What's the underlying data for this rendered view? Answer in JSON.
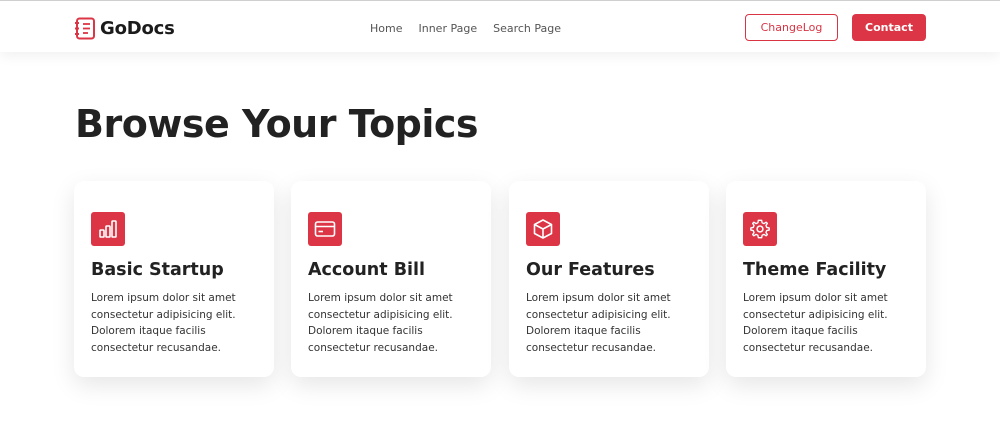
{
  "brand": {
    "name": "GoDocs",
    "accent": "#dc3545"
  },
  "nav": {
    "items": [
      "Home",
      "Inner Page",
      "Search Page"
    ]
  },
  "header": {
    "changelog_label": "ChangeLog",
    "contact_label": "Contact"
  },
  "main": {
    "title": "Browse Your Topics",
    "cards": [
      {
        "icon": "bar-chart-icon",
        "title": "Basic Startup",
        "text": "Lorem ipsum dolor sit amet consectetur adipisicing elit. Dolorem itaque facilis consectetur recusandae."
      },
      {
        "icon": "credit-card-icon",
        "title": "Account Bill",
        "text": "Lorem ipsum dolor sit amet consectetur adipisicing elit. Dolorem itaque facilis consectetur recusandae."
      },
      {
        "icon": "box-icon",
        "title": "Our Features",
        "text": "Lorem ipsum dolor sit amet consectetur adipisicing elit. Dolorem itaque facilis consectetur recusandae."
      },
      {
        "icon": "gear-icon",
        "title": "Theme Facility",
        "text": "Lorem ipsum dolor sit amet consectetur adipisicing elit. Dolorem itaque facilis consectetur recusandae."
      }
    ]
  }
}
